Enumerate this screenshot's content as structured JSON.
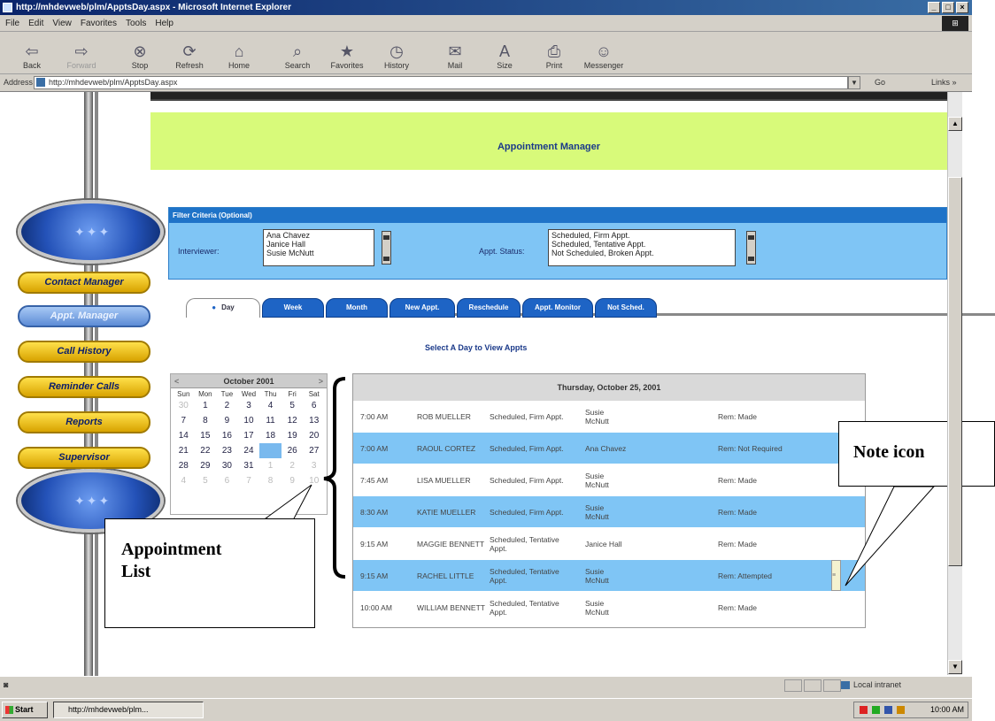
{
  "window": {
    "title": "http://mhdevweb/plm/ApptsDay.aspx - Microsoft Internet Explorer",
    "controls": [
      "_",
      "□",
      "×"
    ]
  },
  "menu": [
    "File",
    "Edit",
    "View",
    "Favorites",
    "Tools",
    "Help"
  ],
  "toolbar": {
    "back": "Back",
    "forward": "Forward",
    "stop": "Stop",
    "refresh": "Refresh",
    "home": "Home",
    "search": "Search",
    "favorites": "Favorites",
    "history": "History",
    "mail": "Mail",
    "size": "Size",
    "print": "Print",
    "messenger": "Messenger"
  },
  "address": {
    "label": "Address",
    "url": "http://mhdevweb/plm/ApptsDay.aspx",
    "go": "Go",
    "links": "Links »"
  },
  "page": {
    "title": "Appointment Manager",
    "nav": [
      "Contact Manager",
      "Appt. Manager",
      "Call History",
      "Reminder Calls",
      "Reports",
      "Supervisor"
    ],
    "filter": {
      "heading": "Filter Criteria (Optional)",
      "interviewer_label": "Interviewer:",
      "interviewers": [
        "Ana Chavez",
        "Janice Hall",
        "Susie McNutt"
      ],
      "status_label": "Appt. Status:",
      "statuses": [
        "Scheduled, Firm Appt.",
        "Scheduled, Tentative Appt.",
        "Not Scheduled, Broken Appt."
      ]
    },
    "tabs": [
      "Day",
      "Week",
      "Month",
      "New Appt.",
      "Reschedule",
      "Appt. Monitor",
      "Not Sched."
    ],
    "select_day": "Select A Day to View Appts",
    "calendar": {
      "month": "October 2001",
      "prev": "<",
      "next": ">",
      "weekdays": [
        "Sun",
        "Mon",
        "Tue",
        "Wed",
        "Thu",
        "Fri",
        "Sat"
      ],
      "weeks": [
        [
          "30",
          "1",
          "2",
          "3",
          "4",
          "5",
          "6"
        ],
        [
          "7",
          "8",
          "9",
          "10",
          "11",
          "12",
          "13"
        ],
        [
          "14",
          "15",
          "16",
          "17",
          "18",
          "19",
          "20"
        ],
        [
          "21",
          "22",
          "23",
          "24",
          "25",
          "26",
          "27"
        ],
        [
          "28",
          "29",
          "30",
          "31",
          "1",
          "2",
          "3"
        ],
        [
          "4",
          "5",
          "6",
          "7",
          "8",
          "9",
          "10"
        ]
      ],
      "selected": "25"
    },
    "appointments": {
      "date": "Thursday, October 25, 2001",
      "rows": [
        {
          "time": "7:00 AM",
          "name": "ROB MUELLER",
          "status": "Scheduled, Firm Appt.",
          "interviewer": "Susie McNutt",
          "reminder": "Rem: Made"
        },
        {
          "time": "7:00 AM",
          "name": "RAOUL CORTEZ",
          "status": "Scheduled, Firm Appt.",
          "interviewer": "Ana Chavez",
          "reminder": "Rem: Not Required"
        },
        {
          "time": "7:45 AM",
          "name": "LISA MUELLER",
          "status": "Scheduled, Firm Appt.",
          "interviewer": "Susie McNutt",
          "reminder": "Rem: Made"
        },
        {
          "time": "8:30 AM",
          "name": "KATIE MUELLER",
          "status": "Scheduled, Firm Appt.",
          "interviewer": "Susie McNutt",
          "reminder": "Rem: Made"
        },
        {
          "time": "9:15 AM",
          "name": "MAGGIE BENNETT",
          "status": "Scheduled, Tentative Appt.",
          "interviewer": "Janice Hall",
          "reminder": "Rem: Made"
        },
        {
          "time": "9:15 AM",
          "name": "RACHEL LITTLE",
          "status": "Scheduled, Tentative Appt.",
          "interviewer": "Susie McNutt",
          "reminder": "Rem: Attempted"
        },
        {
          "time": "10:00 AM",
          "name": "WILLIAM BENNETT",
          "status": "Scheduled, Tentative Appt.",
          "interviewer": "Susie McNutt",
          "reminder": "Rem: Made"
        }
      ]
    }
  },
  "annotations": {
    "appointment_list": "Appointment\nList",
    "note_icon": "Note icon"
  },
  "status": {
    "zone": "Local intranet"
  },
  "taskbar": {
    "start": "Start",
    "item": "http://mhdevweb/plm...",
    "clock": "10:00 AM"
  }
}
